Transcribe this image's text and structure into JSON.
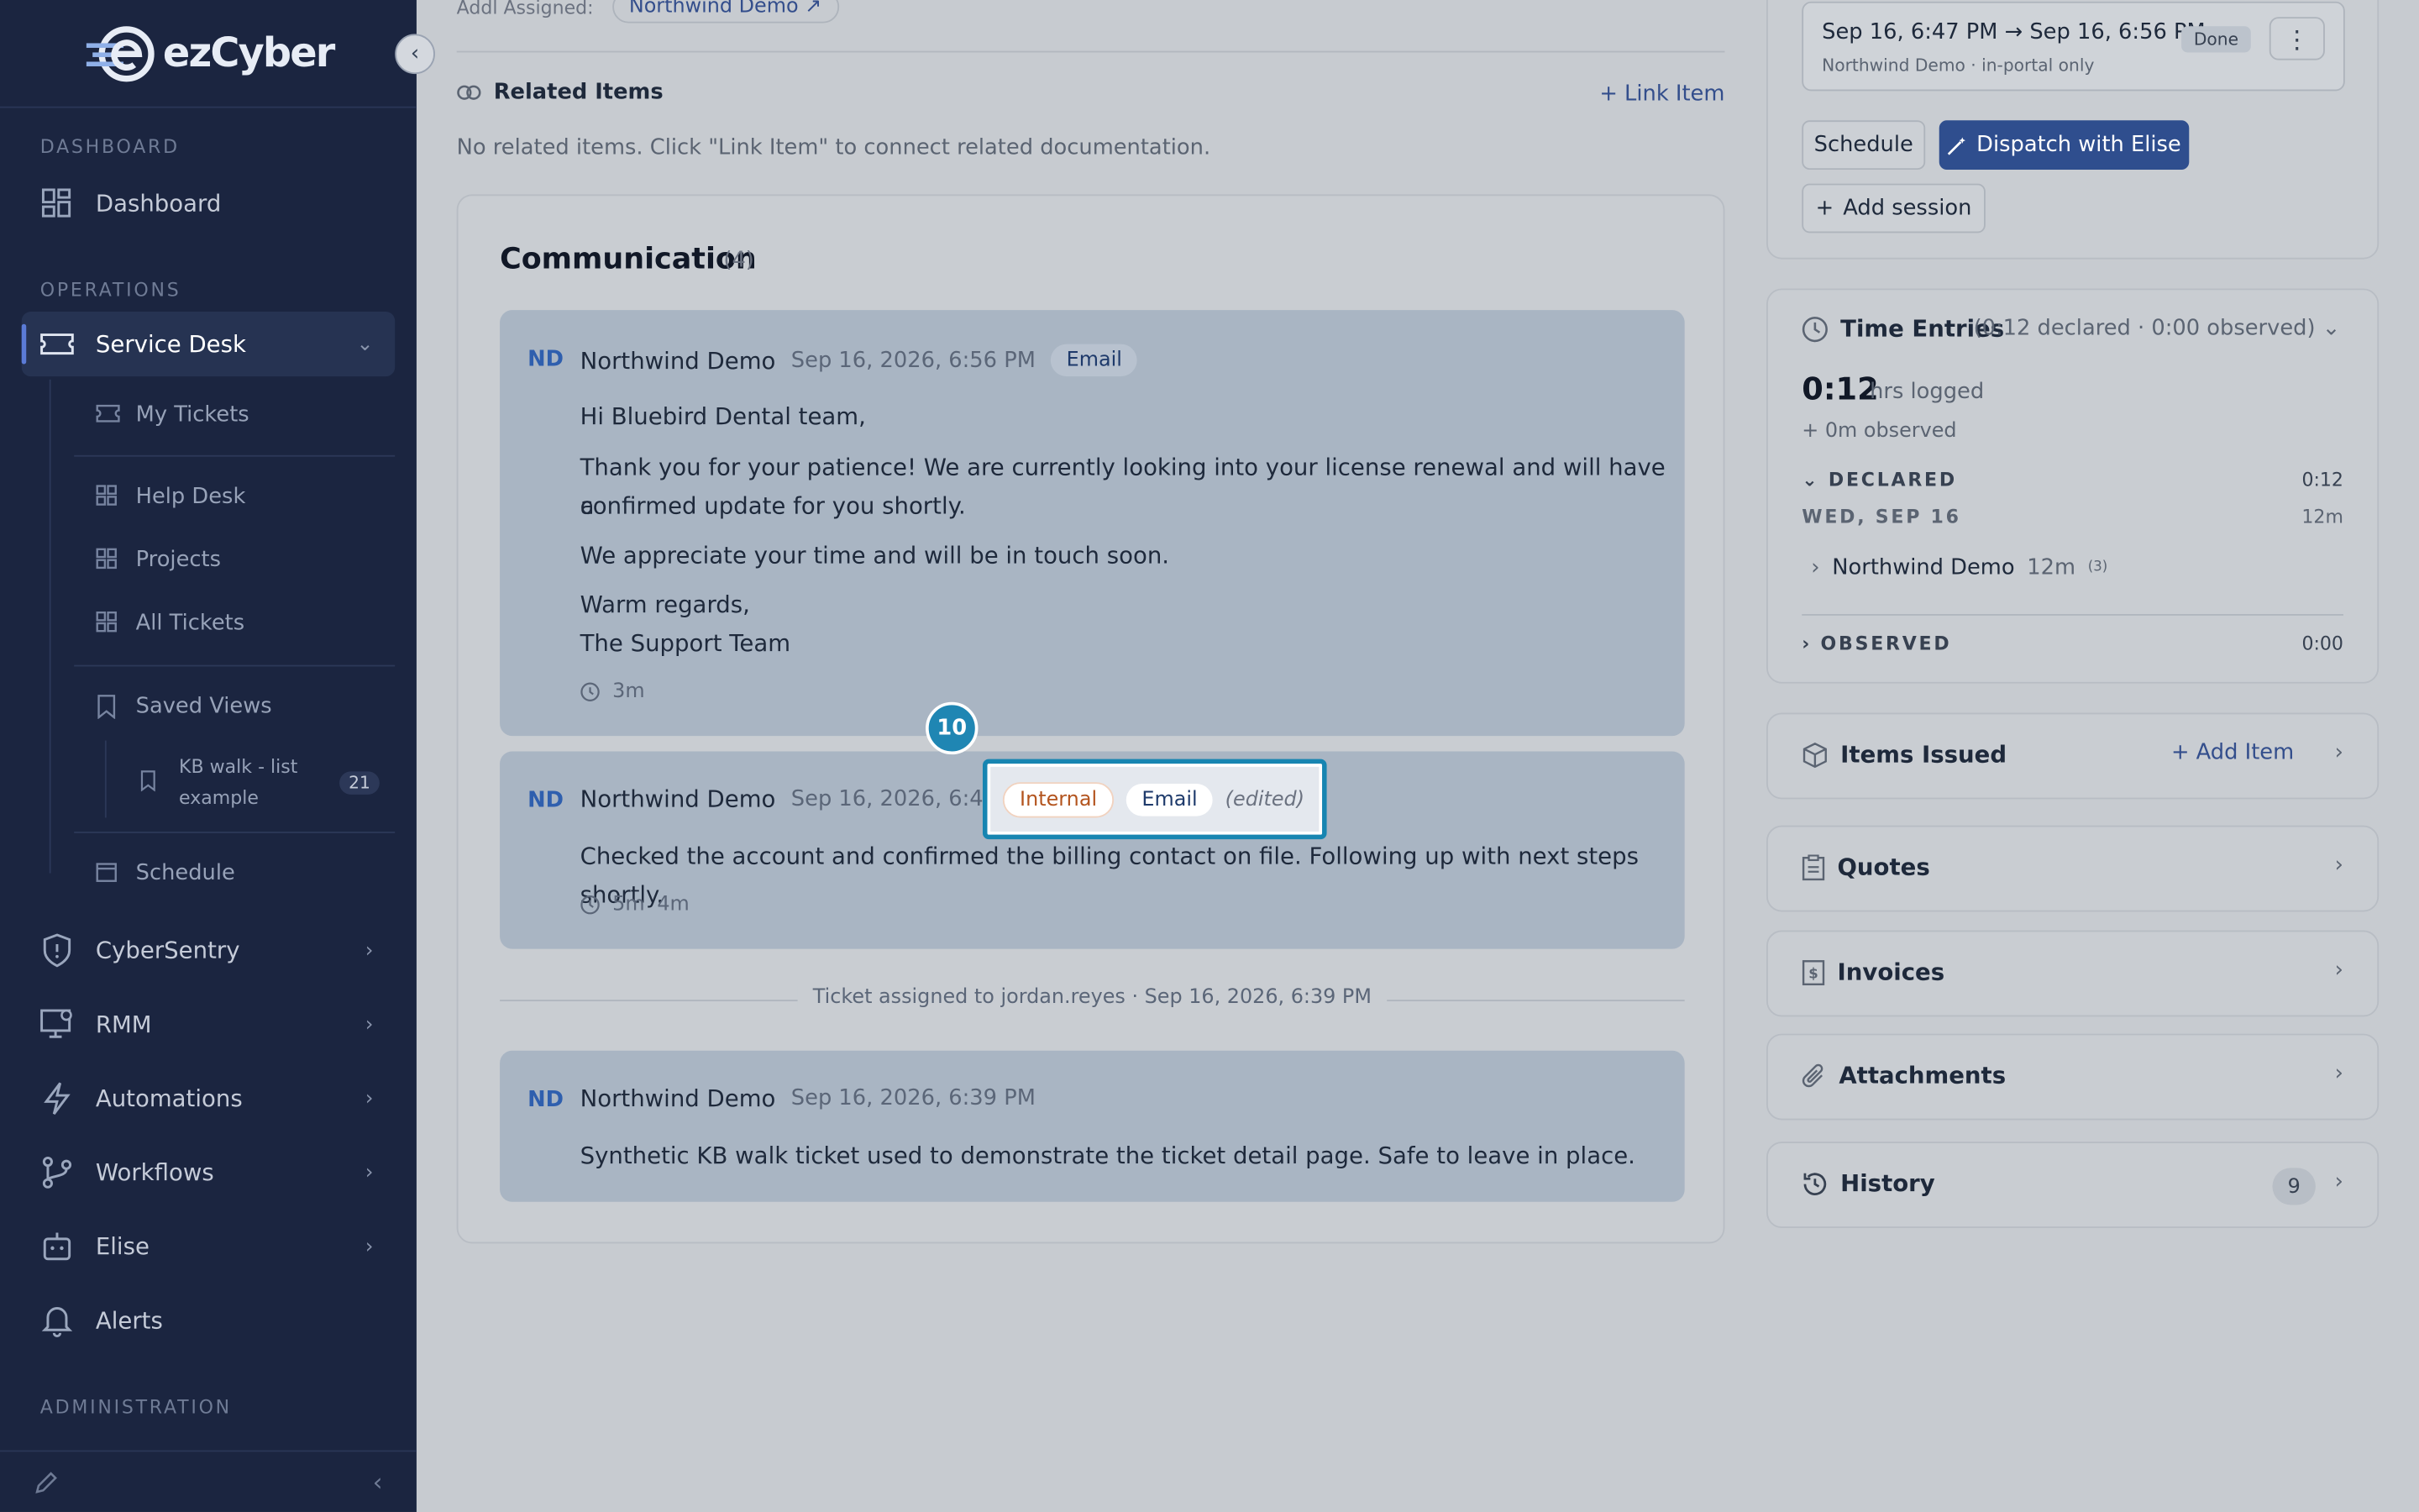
{
  "sidebar": {
    "brand": "ezCyber",
    "sections": {
      "dashboard": "DASHBOARD",
      "operations": "OPERATIONS",
      "administration": "ADMINISTRATION"
    },
    "items": {
      "dashboard": "Dashboard",
      "service_desk": "Service Desk",
      "my_tickets": "My Tickets",
      "help_desk": "Help Desk",
      "projects": "Projects",
      "all_tickets": "All Tickets",
      "saved_views": "Saved Views",
      "kb_walk": "KB walk - list example",
      "kb_walk_count": "21",
      "schedule": "Schedule",
      "cybersentry": "CyberSentry",
      "rmm": "RMM",
      "automations": "Automations",
      "workflows": "Workflows",
      "elise": "Elise",
      "alerts": "Alerts"
    }
  },
  "main": {
    "addl_assigned_label": "Addl Assigned:",
    "addl_assigned_value": "Northwind Demo ↗",
    "related": {
      "title": "Related Items",
      "link_label": "+ Link Item",
      "empty": "No related items. Click \"Link Item\" to connect related documentation."
    },
    "communication": {
      "title": "Communication",
      "count": "(4)",
      "messages": [
        {
          "initials": "ND",
          "author": "Northwind Demo",
          "date": "Sep 16, 2026, 6:56 PM",
          "tag": "Email",
          "lines": [
            "Hi Bluebird Dental team,",
            "Thank you for your patience! We are currently looking into your license renewal and will have a",
            "confirmed update for you shortly.",
            "We appreciate your time and will be in touch soon.",
            "Warm regards,",
            "The Support Team"
          ],
          "duration": "3m"
        },
        {
          "initials": "ND",
          "author": "Northwind Demo",
          "date": "Sep 16, 2026, 6:46 PM",
          "tag_internal": "Internal",
          "tag": "Email",
          "edited": "(edited)",
          "lines": [
            "Checked the account and confirmed the billing contact on file. Following up with next steps shortly."
          ],
          "duration": "5m",
          "duration2": "4m"
        },
        {
          "initials": "ND",
          "author": "Northwind Demo",
          "date": "Sep 16, 2026, 6:39 PM",
          "lines": [
            "Synthetic KB walk ticket used to demonstrate the ticket detail page. Safe to leave in place."
          ]
        }
      ],
      "event": "Ticket assigned to jordan.reyes · Sep 16, 2026, 6:39 PM"
    },
    "step_badge": "10"
  },
  "right": {
    "session": {
      "time": "Sep 16, 6:47 PM → Sep 16, 6:56 PM",
      "sub": "Northwind Demo · in-portal only",
      "status": "Done"
    },
    "buttons": {
      "schedule": "Schedule",
      "dispatch": "Dispatch with Elise",
      "add_session": "Add session"
    },
    "time_entries": {
      "title": "Time Entries",
      "summary": "(0:12 declared · 0:00 observed)",
      "total": "0:12",
      "total_unit": "hrs logged",
      "observed_line": "+ 0m observed",
      "declared_label": "DECLARED",
      "declared_value": "0:12",
      "day_label": "WED, SEP 16",
      "day_value": "12m",
      "person": "Northwind Demo",
      "person_time": "12m",
      "person_count": "(3)",
      "observed_label": "OBSERVED",
      "observed_value": "0:00"
    },
    "cards": {
      "items_issued": "Items Issued",
      "add_item": "+ Add Item",
      "quotes": "Quotes",
      "invoices": "Invoices",
      "attachments": "Attachments",
      "history": "History",
      "history_count": "9"
    }
  },
  "colors": {
    "sidebar_bg": "#1b2540",
    "accent": "#2f4e8e",
    "highlight": "#1785b1",
    "internal": "#b3541e"
  }
}
